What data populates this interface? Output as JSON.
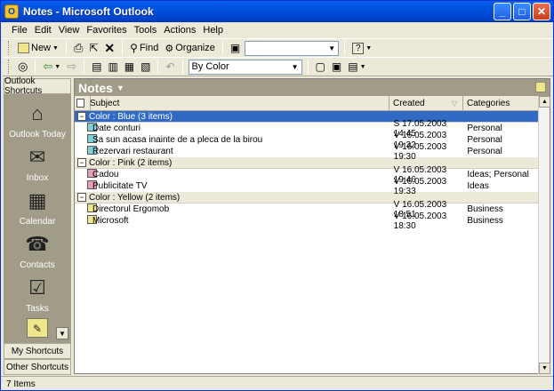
{
  "window": {
    "title": "Notes - Microsoft Outlook",
    "icon": "outlook-icon"
  },
  "menu": [
    "File",
    "Edit",
    "View",
    "Favorites",
    "Tools",
    "Actions",
    "Help"
  ],
  "toolbar1": {
    "new_label": "New",
    "find_label": "Find",
    "organize_label": "Organize",
    "address_combo_value": ""
  },
  "toolbar2": {
    "view_combo_value": "By Color"
  },
  "left_bar": {
    "header": "Outlook Shortcuts",
    "items": [
      {
        "label": "Outlook Today",
        "icon": "house-icon"
      },
      {
        "label": "Inbox",
        "icon": "inbox-icon"
      },
      {
        "label": "Calendar",
        "icon": "calendar-icon"
      },
      {
        "label": "Contacts",
        "icon": "contacts-icon"
      },
      {
        "label": "Tasks",
        "icon": "tasks-icon"
      },
      {
        "label": "",
        "icon": "notes-icon"
      }
    ],
    "my_shortcuts": "My Shortcuts",
    "other_shortcuts": "Other Shortcuts"
  },
  "folder": {
    "title": "Notes"
  },
  "columns": {
    "subject": "Subject",
    "created": "Created",
    "categories": "Categories"
  },
  "groups": [
    {
      "label": "Color : Blue (3 items)",
      "color": "blue",
      "items": [
        {
          "subject": "Date conturi",
          "created": "S 17.05.2003 14:45",
          "categories": "Personal"
        },
        {
          "subject": "Sa sun acasa inainte de a pleca de la birou",
          "created": "V 16.05.2003 19:32",
          "categories": "Personal"
        },
        {
          "subject": "Rezervari restaurant",
          "created": "V 16.05.2003 19:30",
          "categories": "Personal"
        }
      ]
    },
    {
      "label": "Color : Pink (2 items)",
      "color": "pink",
      "items": [
        {
          "subject": "Cadou",
          "created": "V 16.05.2003 19:46",
          "categories": "Ideas; Personal"
        },
        {
          "subject": "Publicitate TV",
          "created": "V 16.05.2003 19:33",
          "categories": "Ideas"
        }
      ]
    },
    {
      "label": "Color : Yellow (2 items)",
      "color": "yellow",
      "items": [
        {
          "subject": "Directorul Ergomob",
          "created": "V 16.05.2003 18:51",
          "categories": "Business"
        },
        {
          "subject": "Microsoft",
          "created": "V 16.05.2003 18:30",
          "categories": "Business"
        }
      ]
    }
  ],
  "status": {
    "text": "7 Items"
  }
}
